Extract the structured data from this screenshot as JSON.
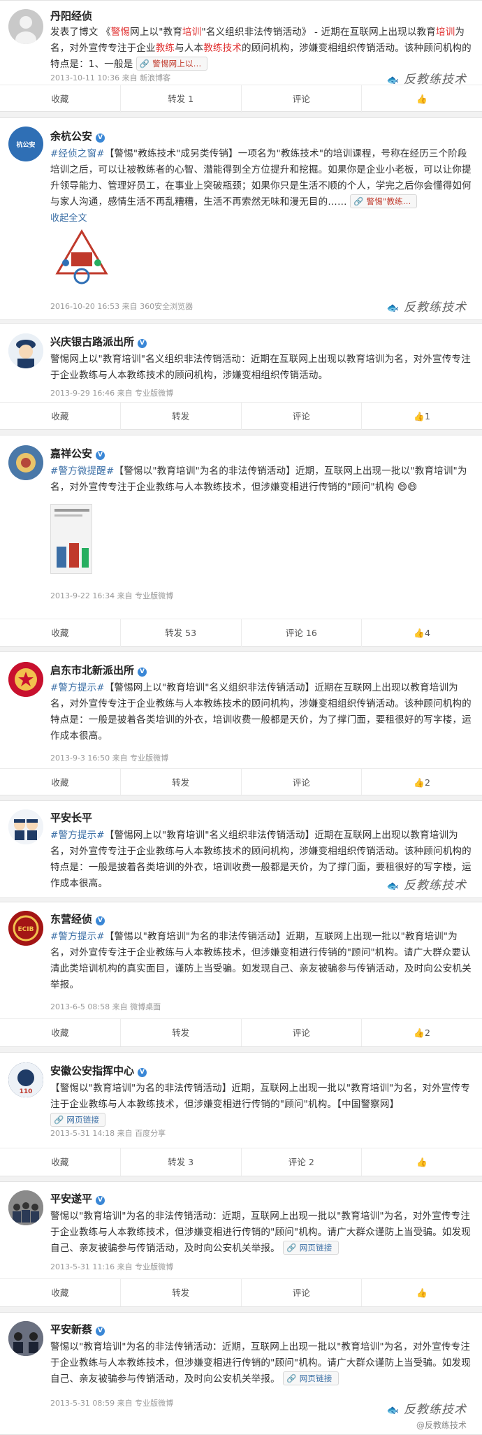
{
  "watermark": "反教练技术",
  "footer": "@反教练技术",
  "actions": {
    "fav": "收藏",
    "repost": "转发",
    "comment": "评论",
    "like": "👍"
  },
  "posts": [
    {
      "name": "丹阳经侦",
      "verified": false,
      "text_a": "发表了博文 《",
      "hl1": "警惕",
      "text_b": "网上以\"教育",
      "hl2": "培训",
      "text_c": "\"名义组织非法传销活动》 - 近期在互联网上出现以教育",
      "hl3": "培训",
      "text_d": "为名，对外宣传专注于企业",
      "hl4": "教练",
      "text_e": "与人本",
      "hl5": "教练技术",
      "text_f": "的顾问机构，涉嫌变相组织传销活动。该种顾问机构的特点是：1、一般是",
      "chip": "警惕网上以...",
      "meta": "2013-10-11 10:36 来自 新浪博客",
      "repost": "转发 1",
      "comment": "评论",
      "like": ""
    },
    {
      "name": "余杭公安",
      "verified": true,
      "tag": "#经侦之窗#",
      "text": "【警惕\"教练技术\"成另类传销】一项名为\"教练技术\"的培训课程，号称在经历三个阶段培训之后，可以让被教练者的心智、潜能得到全方位提升和挖掘。如果你是企业小老板，可以让你提升领导能力、管理好员工，在事业上突破瓶颈；如果你只是生活不顺的个人，学完之后你会懂得如何与家人沟通，感情生活不再乱糟糟，生活不再索然无味和漫无目的……",
      "chip": "警惕\"教练...",
      "collapse": "收起全文",
      "img_label": "教练",
      "meta": "2016-10-20 16:53 来自 360安全浏览器"
    },
    {
      "name": "兴庆银古路派出所",
      "verified": true,
      "text": "警惕网上以\"教育培训\"名义组织非法传销活动：近期在互联网上出现以教育培训为名，对外宣传专注于企业教练与人本教练技术的顾问机构，涉嫌变相组织传销活动。",
      "meta": "2013-9-29 16:46 来自 专业版微博",
      "repost": "转发",
      "comment": "评论",
      "like": "1"
    },
    {
      "name": "嘉祥公安",
      "verified": true,
      "tag": "#警方微提醒#",
      "text": "【警惕以\"教育培训\"为名的非法传销活动】近期，互联网上出现一批以\"教育培训\"为名，对外宣传专注于企业教练与人本教练技术，但涉嫌变相进行传销的\"顾问\"机构",
      "meta": "2013-9-22 16:34 来自 专业版微博",
      "repost": "转发 53",
      "comment": "评论 16",
      "like": "4"
    },
    {
      "name": "启东市北新派出所",
      "verified": true,
      "tag": "#警方提示#",
      "text": "【警惕网上以\"教育培训\"名义组织非法传销活动】近期在互联网上出现以教育培训为名，对外宣传专注于企业教练与人本教练技术的顾问机构，涉嫌变相组织传销活动。该种顾问机构的特点是：一般是披着各类培训的外衣，培训收费一般都是天价，为了撑门面，要租很好的写字楼，运作成本很高。",
      "meta": "2013-9-3 16:50 来自 专业版微博",
      "repost": "转发",
      "comment": "评论",
      "like": "2"
    },
    {
      "name": "平安长平",
      "verified": false,
      "tag": "#警方提示#",
      "text": "【警惕网上以\"教育培训\"名义组织非法传销活动】近期在互联网上出现以教育培训为名，对外宣传专注于企业教练与人本教练技术的顾问机构，涉嫌变相组织传销活动。该种顾问机构的特点是：一般是披着各类培训的外衣，培训收费一般都是天价，为了撑门面，要租很好的写字楼，运作成本很高。"
    },
    {
      "name": "东营经侦",
      "verified": true,
      "tag": "#警方提示#",
      "text": "【警惕以\"教育培训\"为名的非法传销活动】近期，互联网上出现一批以\"教育培训\"为名，对外宣传专注于企业教练与人本教练技术，但涉嫌变相进行传销的\"顾问\"机构。请广大群众要认清此类培训机构的真实面目，谨防上当受骗。如发现自己、亲友被骗参与传销活动，及时向公安机关举报。",
      "meta": "2013-6-5 08:58 来自 微博桌面",
      "repost": "转发",
      "comment": "评论",
      "like": "2"
    },
    {
      "name": "安徽公安指挥中心",
      "verified": true,
      "text": "【警惕以\"教育培训\"为名的非法传销活动】近期，互联网上出现一批以\"教育培训\"为名，对外宣传专注于企业教练与人本教练技术，但涉嫌变相进行传销的\"顾问\"机构。【中国警察网】",
      "chip": "网页链接",
      "meta": "2013-5-31 14:18 来自 百度分享",
      "repost": "转发 3",
      "comment": "评论 2",
      "like": ""
    },
    {
      "name": "平安遂平",
      "verified": true,
      "text": "警惕以\"教育培训\"为名的非法传销活动：近期，互联网上出现一批以\"教育培训\"为名，对外宣传专注于企业教练与人本教练技术，但涉嫌变相进行传销的\"顾问\"机构。请广大群众谨防上当受骗。如发现自己、亲友被骗参与传销活动，及时向公安机关举报。",
      "chip": "网页链接",
      "meta": "2013-5-31 11:16 来自 专业版微博",
      "repost": "转发",
      "comment": "评论",
      "like": ""
    },
    {
      "name": "平安新蔡",
      "verified": true,
      "text": "警惕以\"教育培训\"为名的非法传销活动：近期，互联网上出现一批以\"教育培训\"为名，对外宣传专注于企业教练与人本教练技术，但涉嫌变相进行传销的\"顾问\"机构。请广大群众谨防上当受骗。如发现自己、亲友被骗参与传销活动，及时向公安机关举报。",
      "chip": "网页链接",
      "meta": "2013-5-31 08:59 来自 专业版微博"
    }
  ]
}
